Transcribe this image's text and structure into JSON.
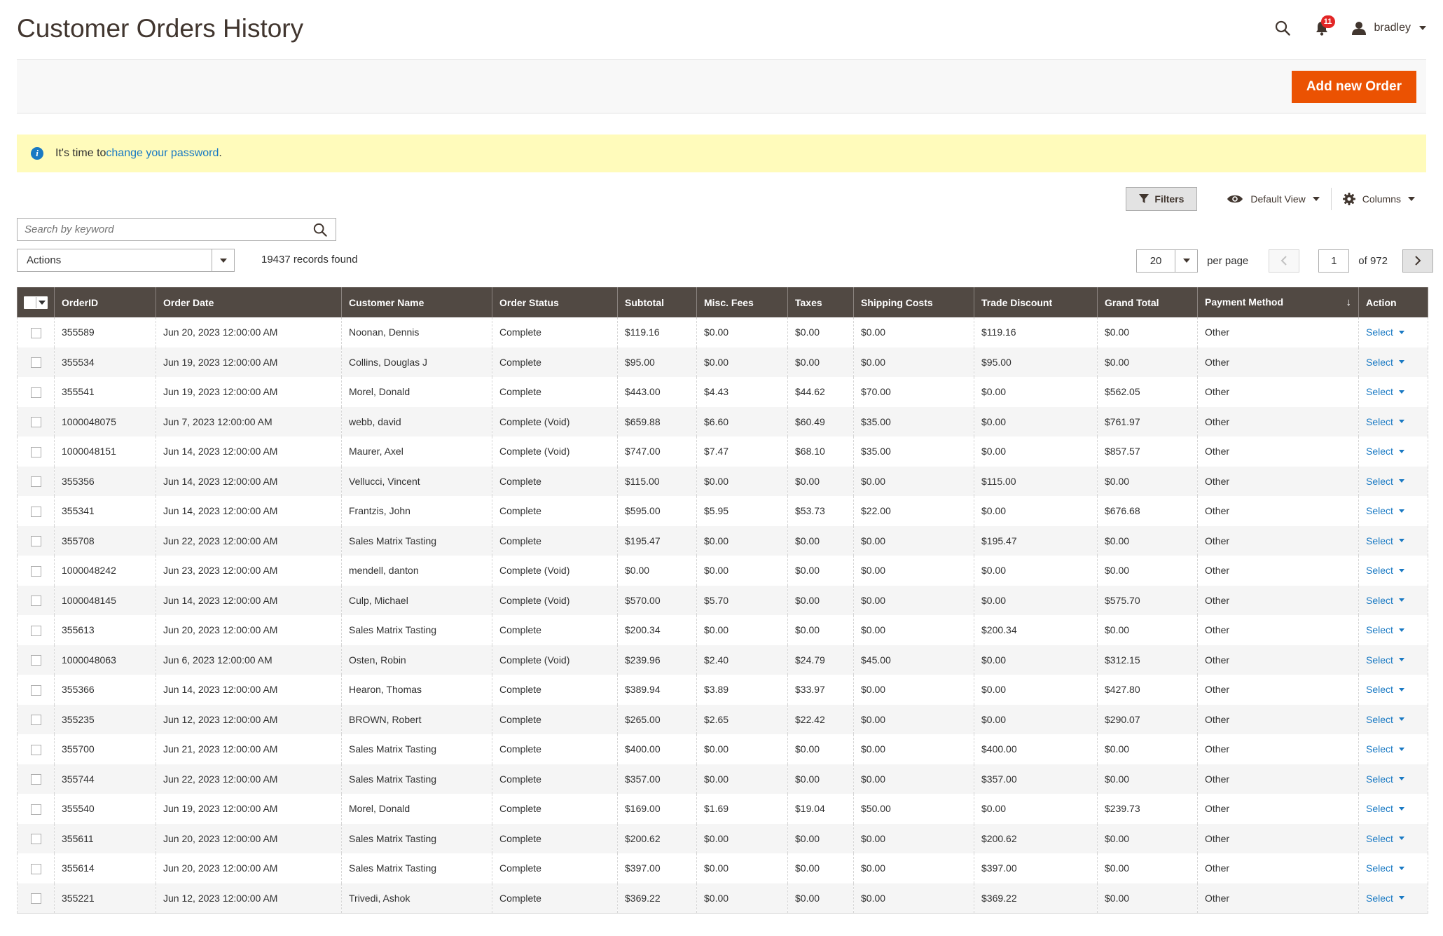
{
  "page": {
    "title": "Customer Orders History"
  },
  "header": {
    "notifications_count": "11",
    "username": "bradley"
  },
  "action_bar": {
    "add_button": "Add new Order"
  },
  "message": {
    "prefix": "It's time to ",
    "link": "change your password",
    "suffix": "."
  },
  "toolbar": {
    "filters": "Filters",
    "view": "Default View",
    "columns": "Columns"
  },
  "search": {
    "placeholder": "Search by keyword"
  },
  "mass_actions": {
    "label": "Actions"
  },
  "records_found": "19437 records found",
  "pager": {
    "per_page_value": "20",
    "per_page_label": "per page",
    "current_page": "1",
    "of_pages": "of 972"
  },
  "colors": {
    "accent": "#eb5202",
    "header_bg": "#514943",
    "link": "#1979c3",
    "notice_bg": "#fffbbb"
  },
  "table": {
    "columns": [
      "OrderID",
      "Order Date",
      "Customer Name",
      "Order Status",
      "Subtotal",
      "Misc. Fees",
      "Taxes",
      "Shipping Costs",
      "Trade Discount",
      "Grand Total",
      "Payment Method",
      "Action"
    ],
    "sort_indicator": "↓",
    "action_label": "Select",
    "rows": [
      [
        "355589",
        "Jun 20, 2023 12:00:00 AM",
        "Noonan, Dennis",
        "Complete",
        "$119.16",
        "$0.00",
        "$0.00",
        "$0.00",
        "$119.16",
        "$0.00",
        "Other"
      ],
      [
        "355534",
        "Jun 19, 2023 12:00:00 AM",
        "Collins, Douglas J",
        "Complete",
        "$95.00",
        "$0.00",
        "$0.00",
        "$0.00",
        "$95.00",
        "$0.00",
        "Other"
      ],
      [
        "355541",
        "Jun 19, 2023 12:00:00 AM",
        "Morel, Donald",
        "Complete",
        "$443.00",
        "$4.43",
        "$44.62",
        "$70.00",
        "$0.00",
        "$562.05",
        "Other"
      ],
      [
        "1000048075",
        "Jun 7, 2023 12:00:00 AM",
        "webb, david",
        "Complete (Void)",
        "$659.88",
        "$6.60",
        "$60.49",
        "$35.00",
        "$0.00",
        "$761.97",
        "Other"
      ],
      [
        "1000048151",
        "Jun 14, 2023 12:00:00 AM",
        "Maurer, Axel",
        "Complete (Void)",
        "$747.00",
        "$7.47",
        "$68.10",
        "$35.00",
        "$0.00",
        "$857.57",
        "Other"
      ],
      [
        "355356",
        "Jun 14, 2023 12:00:00 AM",
        "Vellucci, Vincent",
        "Complete",
        "$115.00",
        "$0.00",
        "$0.00",
        "$0.00",
        "$115.00",
        "$0.00",
        "Other"
      ],
      [
        "355341",
        "Jun 14, 2023 12:00:00 AM",
        "Frantzis, John",
        "Complete",
        "$595.00",
        "$5.95",
        "$53.73",
        "$22.00",
        "$0.00",
        "$676.68",
        "Other"
      ],
      [
        "355708",
        "Jun 22, 2023 12:00:00 AM",
        "Sales Matrix Tasting",
        "Complete",
        "$195.47",
        "$0.00",
        "$0.00",
        "$0.00",
        "$195.47",
        "$0.00",
        "Other"
      ],
      [
        "1000048242",
        "Jun 23, 2023 12:00:00 AM",
        "mendell, danton",
        "Complete (Void)",
        "$0.00",
        "$0.00",
        "$0.00",
        "$0.00",
        "$0.00",
        "$0.00",
        "Other"
      ],
      [
        "1000048145",
        "Jun 14, 2023 12:00:00 AM",
        "Culp, Michael",
        "Complete (Void)",
        "$570.00",
        "$5.70",
        "$0.00",
        "$0.00",
        "$0.00",
        "$575.70",
        "Other"
      ],
      [
        "355613",
        "Jun 20, 2023 12:00:00 AM",
        "Sales Matrix Tasting",
        "Complete",
        "$200.34",
        "$0.00",
        "$0.00",
        "$0.00",
        "$200.34",
        "$0.00",
        "Other"
      ],
      [
        "1000048063",
        "Jun 6, 2023 12:00:00 AM",
        "Osten, Robin",
        "Complete (Void)",
        "$239.96",
        "$2.40",
        "$24.79",
        "$45.00",
        "$0.00",
        "$312.15",
        "Other"
      ],
      [
        "355366",
        "Jun 14, 2023 12:00:00 AM",
        "Hearon, Thomas",
        "Complete",
        "$389.94",
        "$3.89",
        "$33.97",
        "$0.00",
        "$0.00",
        "$427.80",
        "Other"
      ],
      [
        "355235",
        "Jun 12, 2023 12:00:00 AM",
        "BROWN, Robert",
        "Complete",
        "$265.00",
        "$2.65",
        "$22.42",
        "$0.00",
        "$0.00",
        "$290.07",
        "Other"
      ],
      [
        "355700",
        "Jun 21, 2023 12:00:00 AM",
        "Sales Matrix Tasting",
        "Complete",
        "$400.00",
        "$0.00",
        "$0.00",
        "$0.00",
        "$400.00",
        "$0.00",
        "Other"
      ],
      [
        "355744",
        "Jun 22, 2023 12:00:00 AM",
        "Sales Matrix Tasting",
        "Complete",
        "$357.00",
        "$0.00",
        "$0.00",
        "$0.00",
        "$357.00",
        "$0.00",
        "Other"
      ],
      [
        "355540",
        "Jun 19, 2023 12:00:00 AM",
        "Morel, Donald",
        "Complete",
        "$169.00",
        "$1.69",
        "$19.04",
        "$50.00",
        "$0.00",
        "$239.73",
        "Other"
      ],
      [
        "355611",
        "Jun 20, 2023 12:00:00 AM",
        "Sales Matrix Tasting",
        "Complete",
        "$200.62",
        "$0.00",
        "$0.00",
        "$0.00",
        "$200.62",
        "$0.00",
        "Other"
      ],
      [
        "355614",
        "Jun 20, 2023 12:00:00 AM",
        "Sales Matrix Tasting",
        "Complete",
        "$397.00",
        "$0.00",
        "$0.00",
        "$0.00",
        "$397.00",
        "$0.00",
        "Other"
      ],
      [
        "355221",
        "Jun 12, 2023 12:00:00 AM",
        "Trivedi, Ashok",
        "Complete",
        "$369.22",
        "$0.00",
        "$0.00",
        "$0.00",
        "$369.22",
        "$0.00",
        "Other"
      ]
    ]
  }
}
